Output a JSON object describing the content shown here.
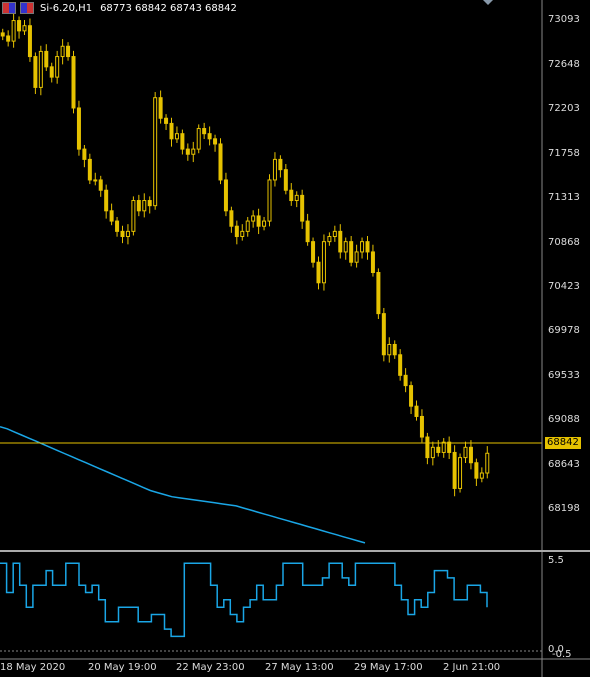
{
  "header": {
    "symbol": "Si-6.20,H1",
    "ohlc": "68773 68842 68743 68842"
  },
  "colors": {
    "candle": "#e6c200",
    "ma": "#1aa6e6",
    "indicator": "#1aa6e6",
    "axis": "#cccccc"
  },
  "price_axis": [
    "73093",
    "72648",
    "72203",
    "71758",
    "71313",
    "70868",
    "70423",
    "69978",
    "69533",
    "69088",
    "68643",
    "68198"
  ],
  "current_price": "68842",
  "indicator_axis": [
    "5.5",
    "0.0",
    "-0.5"
  ],
  "time_axis": [
    "18 May 2020",
    "20 May 19:00",
    "22 May 23:00",
    "27 May 13:00",
    "29 May 17:00",
    "2 Jun 21:00"
  ],
  "chart_data": {
    "type": "line",
    "price_range": [
      67950,
      73250
    ],
    "price_series": [
      72900,
      72850,
      73050,
      72950,
      73000,
      72700,
      72400,
      72750,
      72600,
      72500,
      72700,
      72800,
      72700,
      72200,
      71800,
      71700,
      71500,
      71500,
      71400,
      71200,
      71100,
      71000,
      70950,
      71000,
      71300,
      71200,
      71300,
      71250,
      72300,
      72100,
      72050,
      71900,
      71950,
      71800,
      71750,
      71800,
      72000,
      71950,
      71900,
      71850,
      71500,
      71200,
      71050,
      70950,
      71000,
      71100,
      71150,
      71050,
      71100,
      71500,
      71700,
      71600,
      71400,
      71300,
      71350,
      71100,
      70900,
      70700,
      70500,
      70900,
      70950,
      71000,
      70800,
      70900,
      70700,
      70800,
      70900,
      70800,
      70600,
      70200,
      69800,
      69900,
      69800,
      69600,
      69500,
      69300,
      69200,
      69000,
      68800,
      68900,
      68850,
      68950,
      68850,
      68500,
      68800,
      68900,
      68750,
      68600,
      68650,
      68842
    ],
    "ma_series": [
      69100,
      69080,
      69050,
      69020,
      68990,
      68960,
      68930,
      68900,
      68870,
      68840,
      68810,
      68780,
      68750,
      68720,
      68690,
      68660,
      68630,
      68600,
      68570,
      68540,
      68510,
      68480,
      68460,
      68440,
      68420,
      68410,
      68400,
      68390,
      68380,
      68370,
      68360,
      68350,
      68340,
      68330,
      68310,
      68290,
      68270,
      68250,
      68230,
      68210,
      68190,
      68170,
      68150,
      68130,
      68110,
      68090,
      68070,
      68050,
      68030,
      68010,
      67990,
      67970
    ],
    "indicator_range": [
      -0.5,
      6
    ],
    "indicator_series": [
      5.5,
      3.5,
      5.5,
      4,
      2.5,
      4,
      4,
      5,
      4,
      4,
      5.5,
      5.5,
      4,
      3.5,
      4,
      3,
      1.5,
      1.5,
      2.5,
      2.5,
      2.5,
      1.5,
      1.5,
      2,
      2,
      1,
      0.5,
      0.5,
      5.5,
      5.5,
      5.5,
      5.5,
      4,
      2.5,
      3,
      2,
      1.5,
      2.5,
      3,
      4,
      3,
      3,
      4,
      5.5,
      5.5,
      5.5,
      4,
      4,
      4,
      4.5,
      5.5,
      5.5,
      4.5,
      4,
      5.5,
      5.5,
      5.5,
      5.5,
      5.5,
      5.5,
      4,
      3,
      2,
      3,
      2.5,
      3.5,
      5,
      5,
      4.5,
      3,
      3,
      4,
      4,
      3.5,
      2.5
    ]
  }
}
